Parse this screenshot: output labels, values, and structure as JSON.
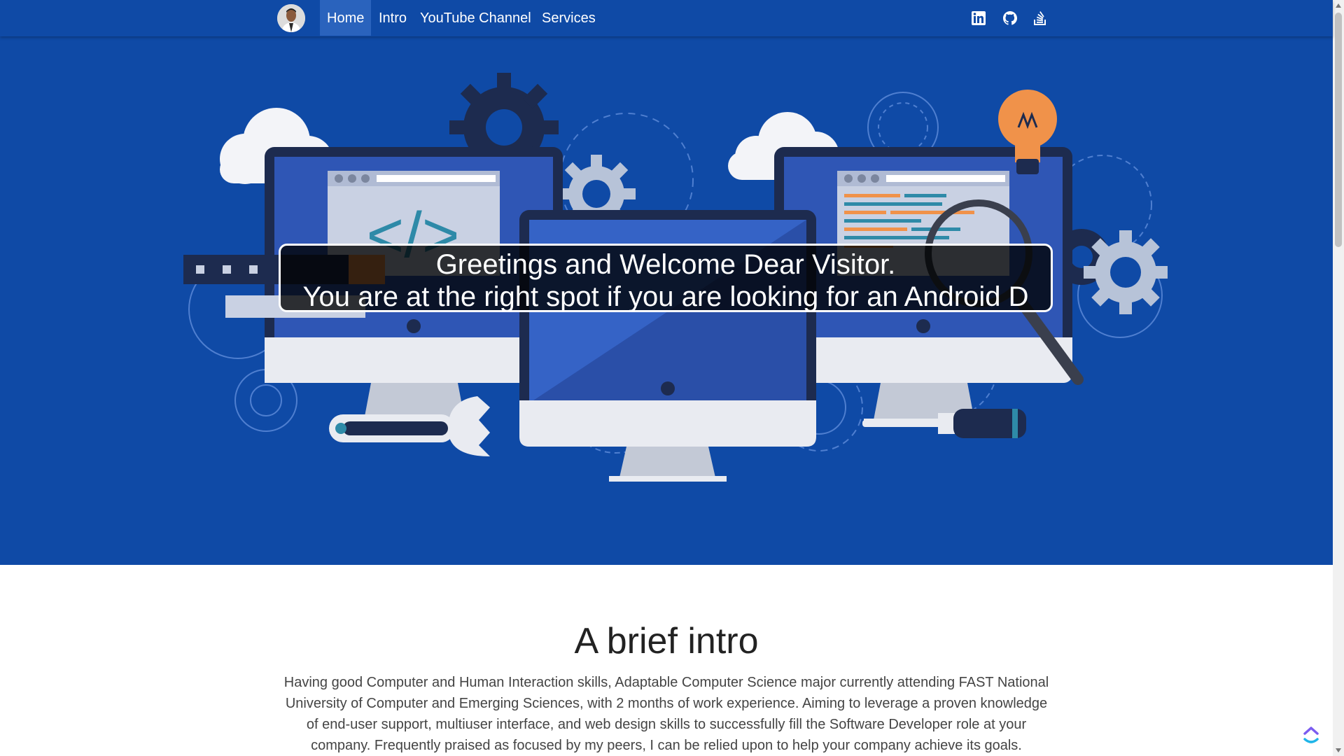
{
  "nav": {
    "items": [
      {
        "label": "Home",
        "active": true
      },
      {
        "label": "Intro",
        "active": false
      },
      {
        "label": "YouTube Channel",
        "active": false
      },
      {
        "label": "Services",
        "active": false
      }
    ],
    "social_icons": [
      "linkedin-icon",
      "github-icon",
      "stackoverflow-icon"
    ]
  },
  "hero": {
    "greeting_line1": "Greetings and Welcome Dear Visitor.",
    "greeting_line2": "You are at the right spot if you are looking for an Android D",
    "illustration_code_symbol": "</>"
  },
  "intro": {
    "title": "A brief intro",
    "text": "Having good Computer and Human Interaction skills, Adaptable Computer Science major currently attending FAST National University of Computer and Emerging Sciences, with 2 months of work experience. Aiming to leverage a proven knowledge of end-user support, multiuser interface, and web design skills to successfully fill the Software Developer role at your company. Frequently praised as focused by my peers, I can be relied upon to help your company achieve its goals."
  },
  "colors": {
    "primary": "#0f4aa6",
    "active_nav": "#2a63bd",
    "bulb": "#f0924a"
  }
}
